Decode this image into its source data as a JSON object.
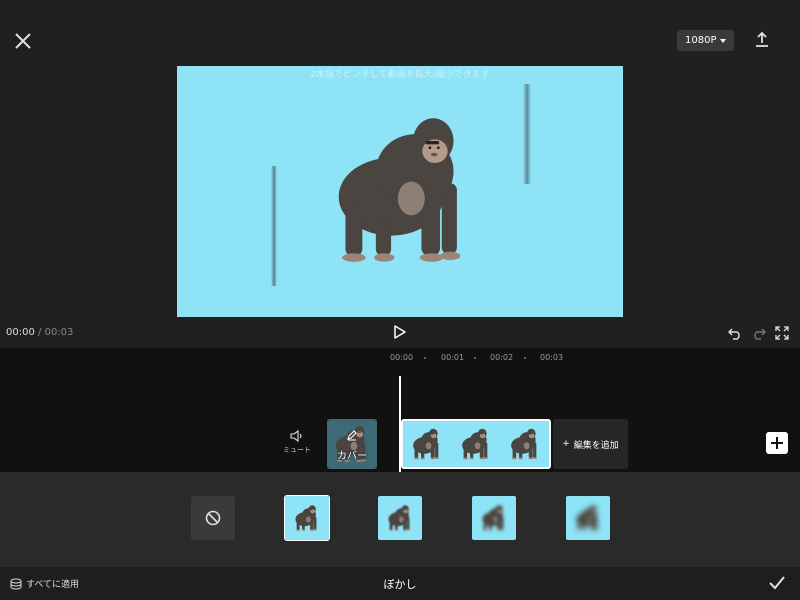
{
  "header": {
    "resolution": "1080P",
    "close_icon": "close-icon",
    "export_icon": "export-icon"
  },
  "preview": {
    "hint": "2本指でピンチして動画を拡大/縮小できます",
    "background": "#8ee3f7"
  },
  "playback": {
    "current_time": "00:00",
    "separator": "/",
    "total_time": "00:03"
  },
  "timeline": {
    "ruler": [
      "00:00",
      "00:01",
      "00:02",
      "00:03"
    ],
    "mute_label": "ミュート",
    "cover_label": "カバー",
    "add_edit_label": "編集を追加"
  },
  "effects": {
    "options": [
      "none",
      "blur-1",
      "blur-2",
      "blur-3",
      "blur-4"
    ],
    "selected": "blur-1"
  },
  "footer": {
    "apply_all": "すべてに適用",
    "title": "ぼかし"
  },
  "colors": {
    "accent_bg": "#8ee3f7",
    "panel_bg": "#2a2a2a",
    "timeline_bg": "#111111"
  }
}
